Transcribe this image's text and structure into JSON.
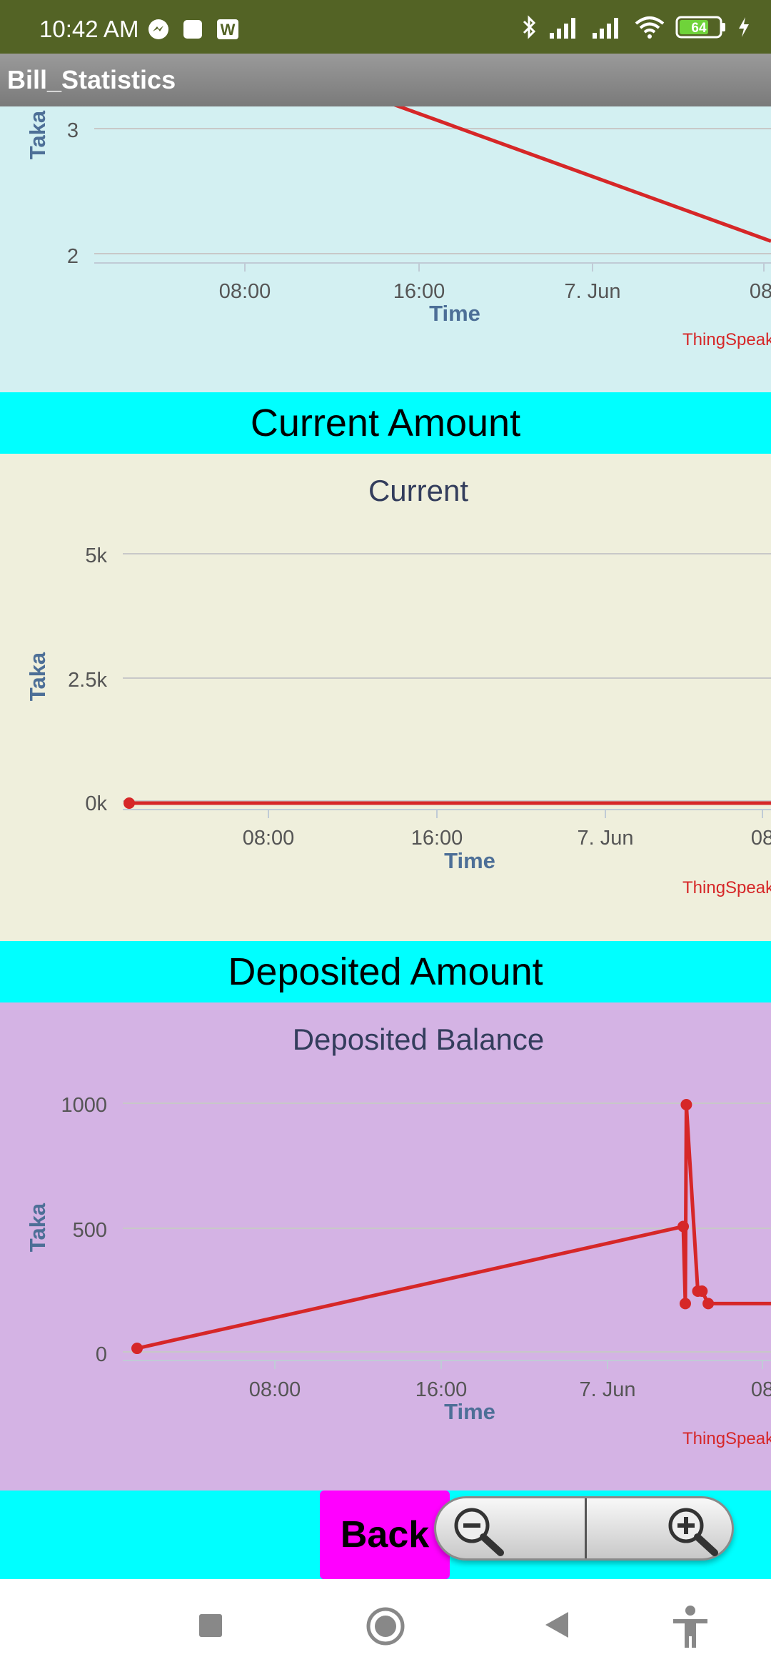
{
  "status_bar": {
    "time": "10:42 AM",
    "battery": "64",
    "icons_left": [
      "messenger-icon",
      "square-notification-icon",
      "w-app-icon"
    ],
    "icons_right": [
      "bluetooth-icon",
      "signal-icon",
      "signal-icon",
      "wifi-icon",
      "battery-icon",
      "charging-icon"
    ]
  },
  "app_bar": {
    "title": "Bill_Statistics"
  },
  "sections": {
    "top": {
      "brand": "ThingSpeak"
    },
    "current": {
      "header": "Current Amount",
      "brand": "ThingSpeak"
    },
    "deposited": {
      "header": "Deposited Amount",
      "brand": "ThingSpeak"
    }
  },
  "chart_data": [
    {
      "type": "line",
      "title": "",
      "xlabel": "Time",
      "ylabel": "Taka",
      "x_ticks": [
        "08:00",
        "16:00",
        "7. Jun",
        "08:"
      ],
      "y_ticks": [
        "3",
        "2"
      ],
      "ylim": [
        1.9,
        3.2
      ],
      "grid": true,
      "series_color": "#d62728",
      "series": [
        {
          "x": [
            "16:00",
            "08:00 (7. Jun)"
          ],
          "values": [
            3.2,
            2.1
          ]
        }
      ]
    },
    {
      "type": "line",
      "title": "Current",
      "xlabel": "Time",
      "ylabel": "Taka",
      "x_ticks": [
        "08:00",
        "16:00",
        "7. Jun",
        "08"
      ],
      "y_ticks": [
        "5k",
        "2.5k",
        "0k"
      ],
      "ylim": [
        0,
        5000
      ],
      "grid": true,
      "series_color": "#d62728",
      "series": [
        {
          "x": [
            "start",
            "end"
          ],
          "values": [
            0,
            0
          ]
        }
      ]
    },
    {
      "type": "line",
      "title": "Deposited Balance",
      "xlabel": "Time",
      "ylabel": "Taka",
      "x_ticks": [
        "08:00",
        "16:00",
        "7. Jun",
        "08"
      ],
      "y_ticks": [
        "1000",
        "500",
        "0"
      ],
      "ylim": [
        0,
        1000
      ],
      "grid": true,
      "series_color": "#d62728",
      "series": [
        {
          "x_hours": [
            0,
            26.2,
            26.3,
            26.35,
            26.9,
            27.1,
            27.4,
            33
          ],
          "values": [
            20,
            510,
            200,
            1000,
            250,
            250,
            200,
            200
          ]
        }
      ]
    }
  ],
  "bottom": {
    "back_label": "Back",
    "zoom_out_icon": "zoom-out-icon",
    "zoom_in_icon": "zoom-in-icon"
  },
  "nav": [
    "recents-square-icon",
    "home-circle-icon",
    "back-triangle-icon",
    "accessibility-icon"
  ]
}
